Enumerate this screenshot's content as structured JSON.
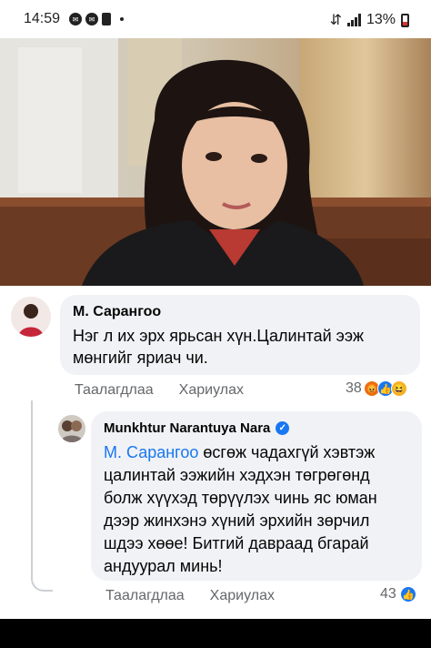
{
  "status_bar": {
    "time": "14:59",
    "battery": "13%",
    "sim_indicator": "⇵"
  },
  "comment1": {
    "author": "М. Сарангоо",
    "text": "Нэг л их эрх ярьсан хүн.Цалинтай ээж мөнгийг яриач чи.",
    "like_label": "Таалагдлаа",
    "reply_label": "Хариулах",
    "reaction_count": "38",
    "reactions": [
      "angry-icon",
      "like-icon",
      "haha-icon"
    ]
  },
  "reply1": {
    "author": "Munkhtur Narantuya Nara",
    "mention": "М. Сарангоо",
    "text": " өсгөж чадахгүй хэвтэж цалинтай ээжийн хэдхэн төгрөгөнд болж хүүхэд төрүүлэх чинь яс юман дээр жинхэнэ хүний эрхийн зөрчил шдээ хөөе! Битгий давраад бгарай андуурал минь!",
    "like_label": "Таалагдлаа",
    "reply_label": "Хариулах",
    "reaction_count": "43",
    "reactions": [
      "like-icon"
    ]
  },
  "colors": {
    "accent": "#1877f2",
    "bubble": "#f0f2f5",
    "meta": "#65676b"
  }
}
